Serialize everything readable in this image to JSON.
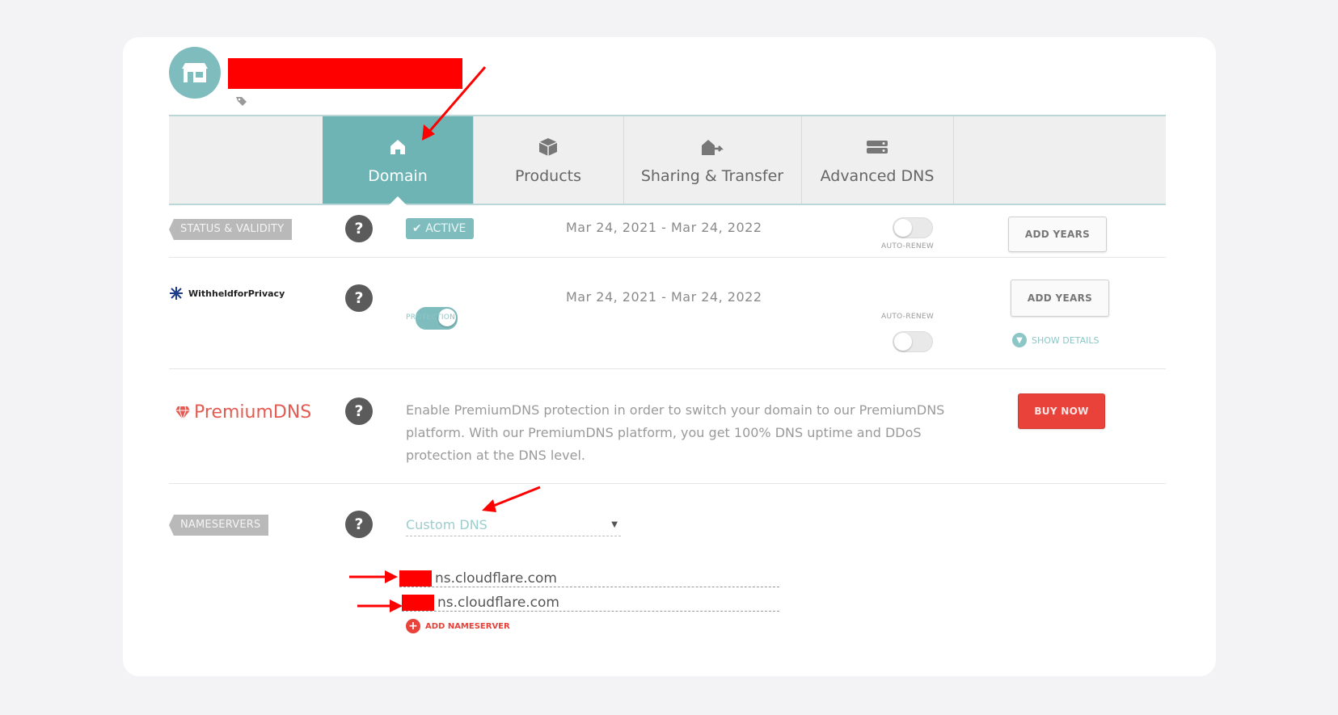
{
  "tabs": [
    {
      "label": "Domain",
      "icon": "home-icon"
    },
    {
      "label": "Products",
      "icon": "box-icon"
    },
    {
      "label": "Sharing & Transfer",
      "icon": "share-transfer-icon"
    },
    {
      "label": "Advanced DNS",
      "icon": "server-icon"
    }
  ],
  "status": {
    "label": "STATUS & VALIDITY",
    "badge": "ACTIVE",
    "dates": "Mar 24, 2021 - Mar 24, 2022",
    "auto_renew_label": "AUTO-RENEW",
    "add_years": "ADD YEARS"
  },
  "privacy": {
    "logo_text": "WithheldforPrivacy",
    "protection_label": "PROTECTION",
    "dates": "Mar 24, 2021 - Mar 24, 2022",
    "auto_renew_label": "AUTO-RENEW",
    "add_years": "ADD YEARS",
    "show_details": "SHOW DETAILS"
  },
  "premium": {
    "logo_text": "PremiumDNS",
    "description": "Enable PremiumDNS protection in order to switch your domain to our PremiumDNS platform. With our PremiumDNS platform, you get 100% DNS uptime and DDoS protection at the DNS level.",
    "buy_now": "BUY NOW"
  },
  "nameservers": {
    "label": "NAMESERVERS",
    "selected": "Custom DNS",
    "entries": [
      "ns.cloudflare.com",
      "ns.cloudflare.com"
    ],
    "add_label": "ADD NAMESERVER"
  },
  "colors": {
    "accent": "#6eb4b5",
    "danger": "#e8423a",
    "redaction": "#ff0000"
  }
}
